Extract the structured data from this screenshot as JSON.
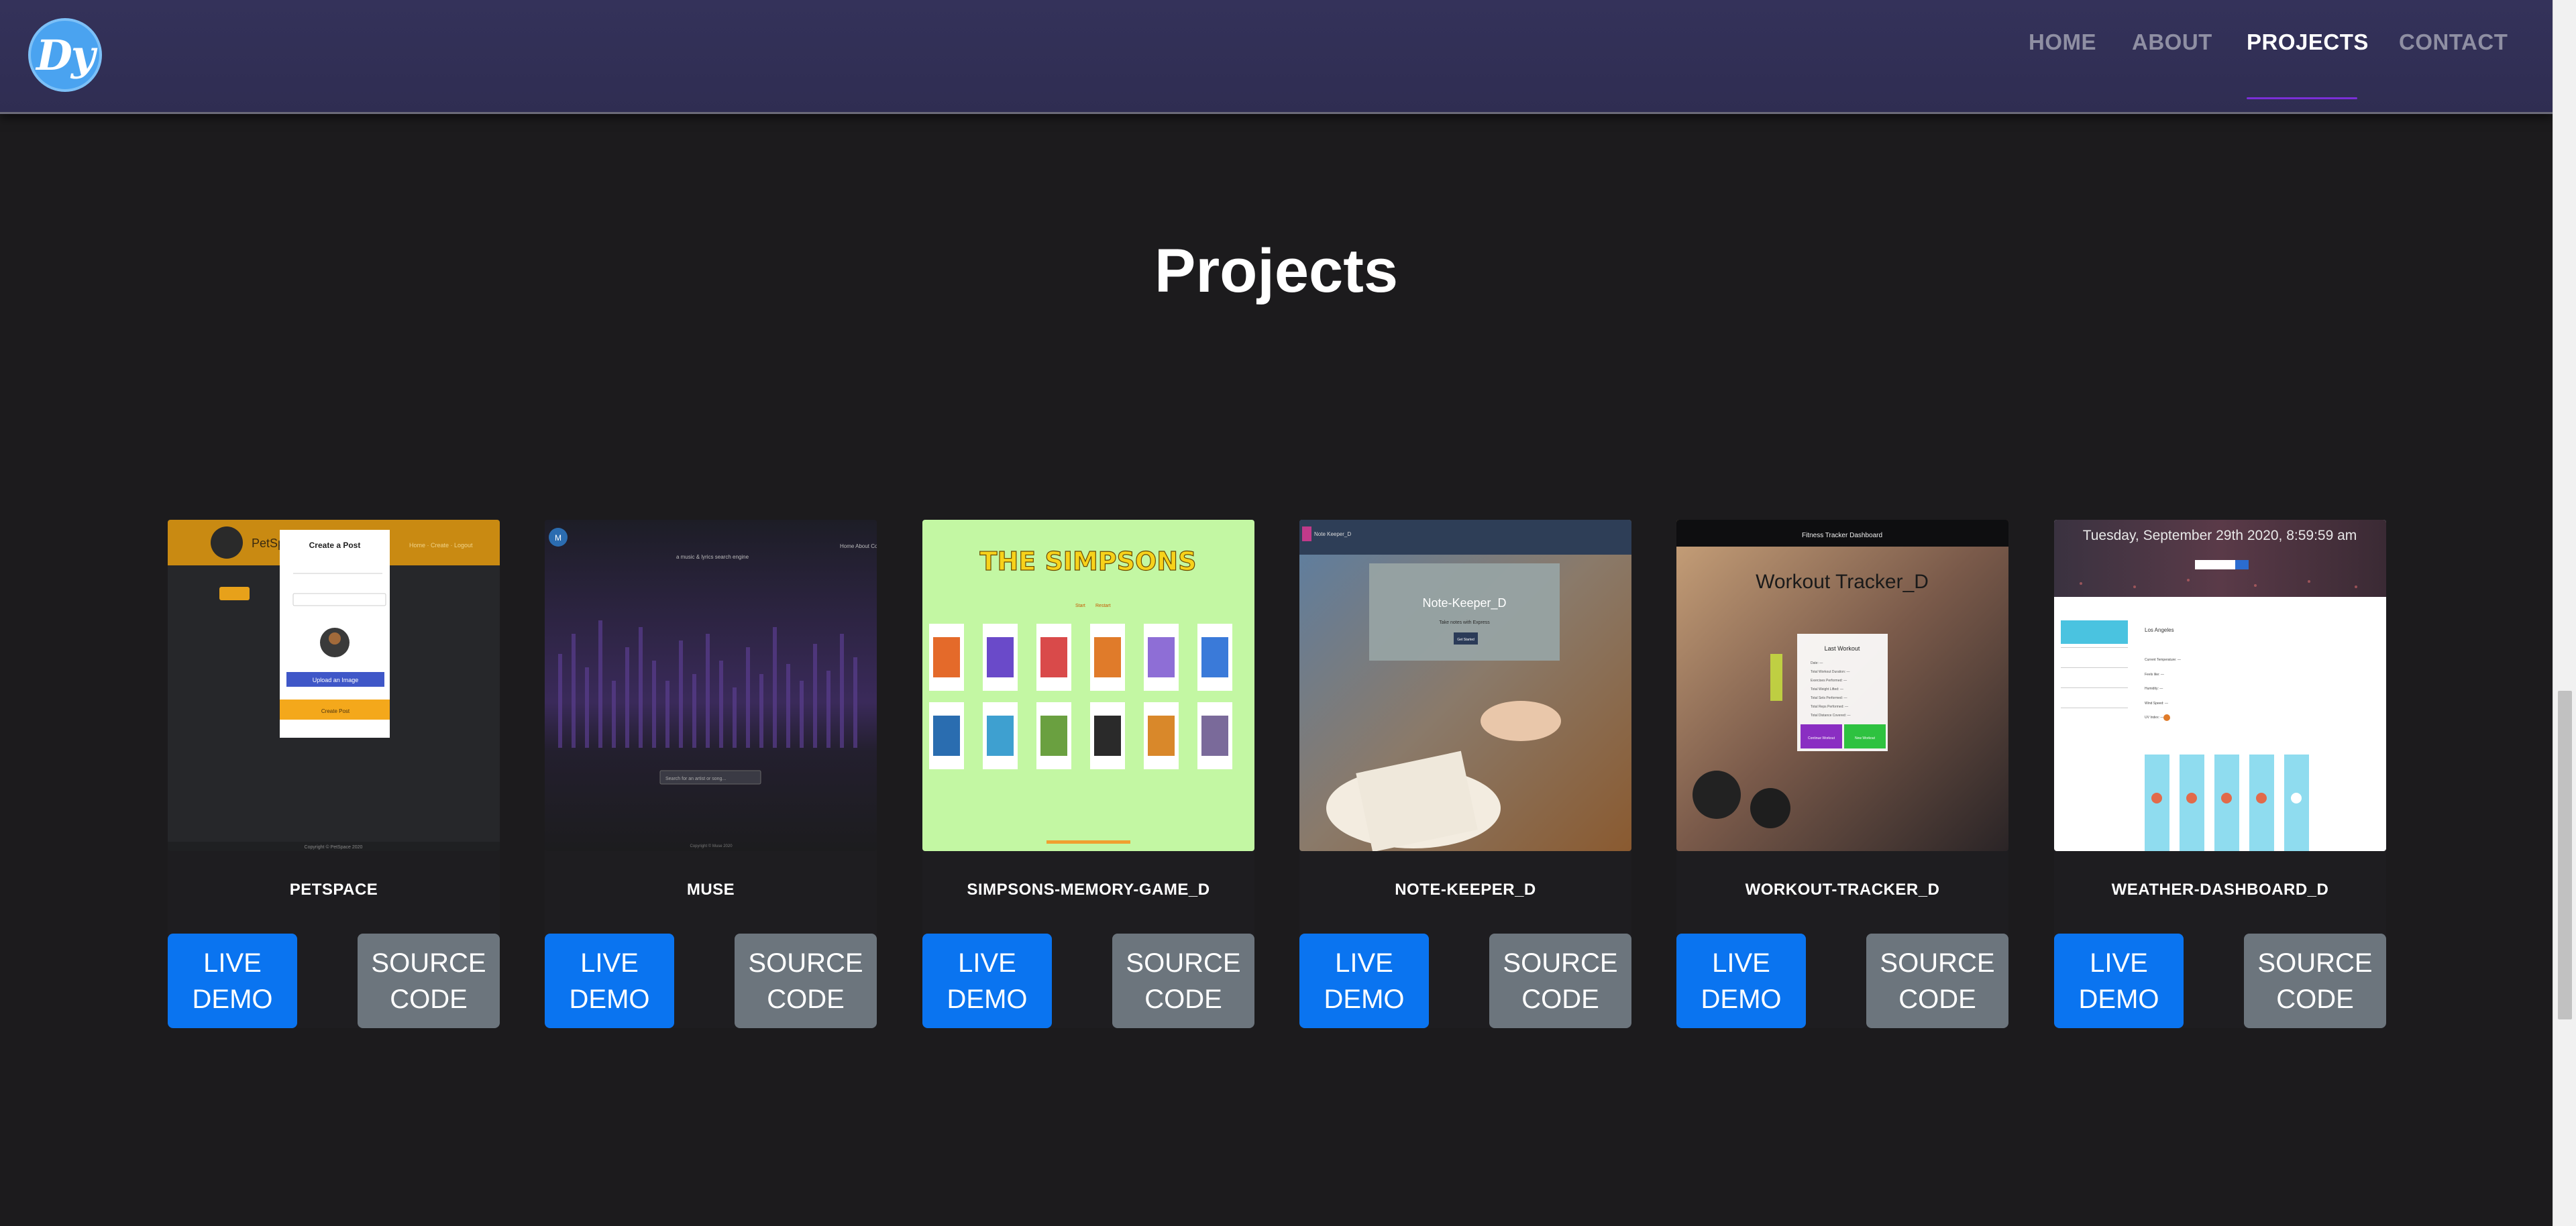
{
  "navbar": {
    "logo_text": "Dy",
    "links": [
      {
        "label": "HOME",
        "active": false
      },
      {
        "label": "ABOUT",
        "active": false
      },
      {
        "label": "PROJECTS",
        "active": true
      },
      {
        "label": "CONTACT",
        "active": false
      }
    ]
  },
  "page_title": "Projects",
  "buttons": {
    "live_line1": "LIVE",
    "live_line2": "DEMO",
    "source_line1": "SOURCE",
    "source_line2": "CODE"
  },
  "projects": [
    {
      "name": "PETSPACE"
    },
    {
      "name": "MUSE"
    },
    {
      "name": "SIMPSONS-MEMORY-GAME_D"
    },
    {
      "name": "NOTE-KEEPER_D"
    },
    {
      "name": "WORKOUT-TRACKER_D"
    },
    {
      "name": "WEATHER-DASHBOARD_D"
    }
  ],
  "thumbnails": {
    "petspace": {
      "header_text": "PetSpace",
      "modal_title": "Create a Post",
      "upload_button": "Upload an Image",
      "footer": "Copyright © PetSpace 2020"
    },
    "muse": {
      "logo_text": "M",
      "search_placeholder": "Search for an artist or song..."
    },
    "simpsons": {
      "logo_text": "THE SIMPSONS"
    },
    "notekeeper": {
      "header_text": "Note Keeper_D",
      "title": "Note-Keeper_D",
      "subtitle": "Take notes with Express",
      "button": "Get Started"
    },
    "workout": {
      "header_text": "Fitness Tracker Dashboard",
      "title": "Workout Tracker_D",
      "card_title": "Last Workout",
      "btn_continue": "Continue Workout",
      "btn_new": "New Workout"
    },
    "weather": {
      "date_text": "Tuesday, September 29th 2020, 8:59:59 am",
      "city": "Los Angeles",
      "search_label": "Search"
    }
  },
  "colors": {
    "background": "#1c1b1d",
    "navbar": "#34325a",
    "live_button": "#0a74f0",
    "source_button": "#6c757d",
    "active_underline": "#7a2fd6"
  }
}
